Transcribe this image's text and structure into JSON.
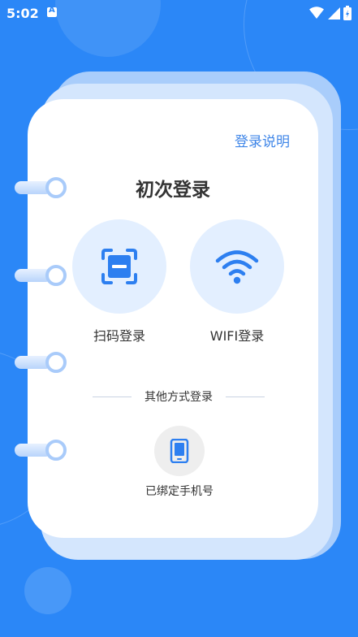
{
  "status_bar": {
    "time": "5:02"
  },
  "login_help": "登录说明",
  "title": "初次登录",
  "options": {
    "scan": {
      "label": "扫码登录",
      "icon": "scan-icon"
    },
    "wifi": {
      "label": "WIFI登录",
      "icon": "wifi-icon"
    }
  },
  "other_methods": "其他方式登录",
  "phone": {
    "label": "已绑定手机号",
    "icon": "phone-icon"
  },
  "colors": {
    "background": "#2b87f7",
    "accent": "#2d7ff0",
    "option_bg": "#e3efff",
    "link": "#3f86e8"
  }
}
